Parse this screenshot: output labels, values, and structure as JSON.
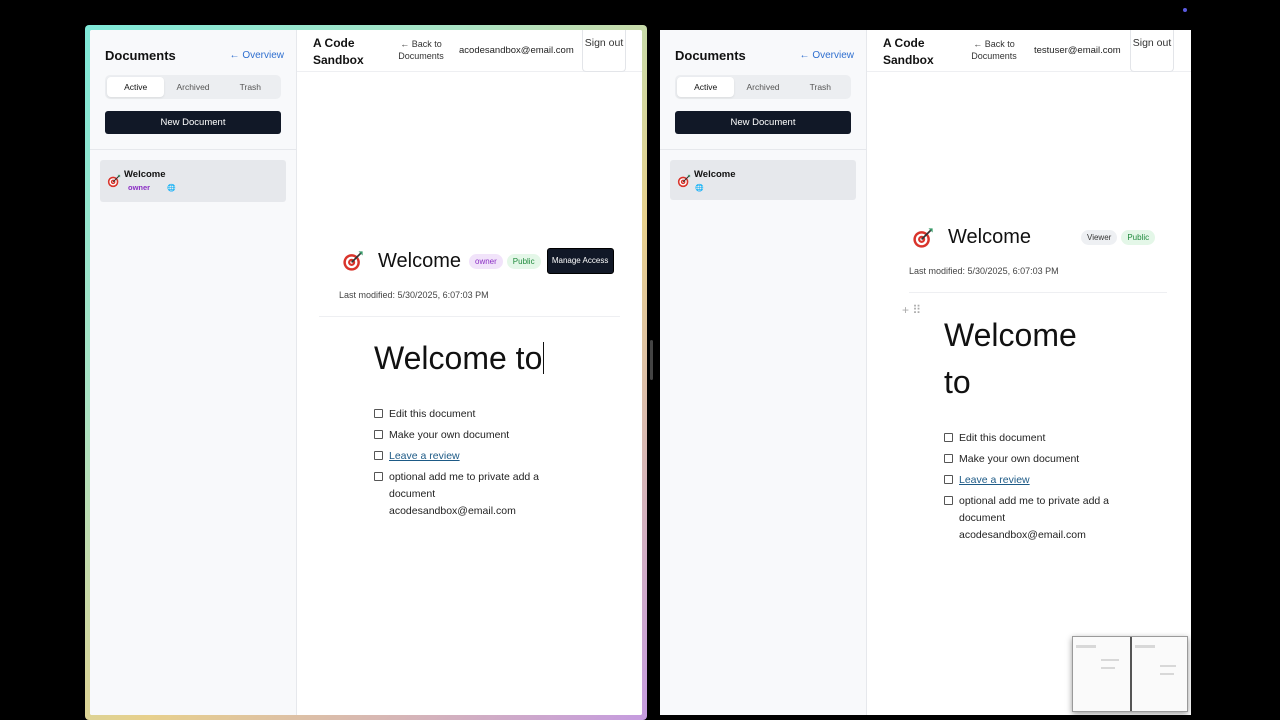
{
  "left_window": {
    "sidebar": {
      "title": "Documents",
      "overview_link": "← Overview",
      "tabs": [
        {
          "label": "Active",
          "active": true
        },
        {
          "label": "Archived",
          "active": false
        },
        {
          "label": "Trash",
          "active": false
        }
      ],
      "new_document_label": "New Document",
      "documents": [
        {
          "title": "Welcome",
          "role": "owner",
          "icon": "dart-target-icon",
          "visibility_icon": "globe-icon"
        }
      ]
    },
    "topbar": {
      "app_title": "A Code Sandbox",
      "back_link": "← Back to Documents",
      "user_email": "acodesandbox@email.com",
      "sign_out": "Sign out"
    },
    "document": {
      "title": "Welcome",
      "role_badge": "owner",
      "visibility_badge": "Public",
      "manage_access": "Manage Access",
      "last_modified": "Last modified: 5/30/2025, 6:07:03 PM",
      "heading": "Welcome to",
      "checklist": [
        {
          "text": "Edit this document",
          "link": false
        },
        {
          "text": "Make your own document",
          "link": false
        },
        {
          "text": "Leave a review",
          "link": true
        },
        {
          "text": "optional add me to private add a document acodesandbox@email.com",
          "link": false
        }
      ]
    }
  },
  "right_window": {
    "sidebar": {
      "title": "Documents",
      "overview_link": "← Overview",
      "tabs": [
        {
          "label": "Active",
          "active": true
        },
        {
          "label": "Archived",
          "active": false
        },
        {
          "label": "Trash",
          "active": false
        }
      ],
      "new_document_label": "New Document",
      "documents": [
        {
          "title": "Welcome",
          "role": "",
          "icon": "dart-target-icon",
          "visibility_icon": "globe-icon"
        }
      ]
    },
    "topbar": {
      "app_title": "A Code Sandbox",
      "back_link": "← Back to Documents",
      "user_email": "testuser@email.com",
      "sign_out": "Sign out"
    },
    "document": {
      "title": "Welcome",
      "role_badge": "Viewer",
      "visibility_badge": "Public",
      "last_modified": "Last modified: 5/30/2025, 6:07:03 PM",
      "heading": "Welcome to",
      "checklist": [
        {
          "text": "Edit this document",
          "link": false
        },
        {
          "text": "Make your own document",
          "link": false
        },
        {
          "text": "Leave a review",
          "link": true
        },
        {
          "text": "optional add me to private add a document acodesandbox@email.com",
          "link": false
        }
      ]
    }
  },
  "colors": {
    "primary_button": "#111827",
    "link_blue": "#2f6fcf",
    "owner_purple": "#8a2ec4",
    "public_green": "#1f8a3c"
  }
}
